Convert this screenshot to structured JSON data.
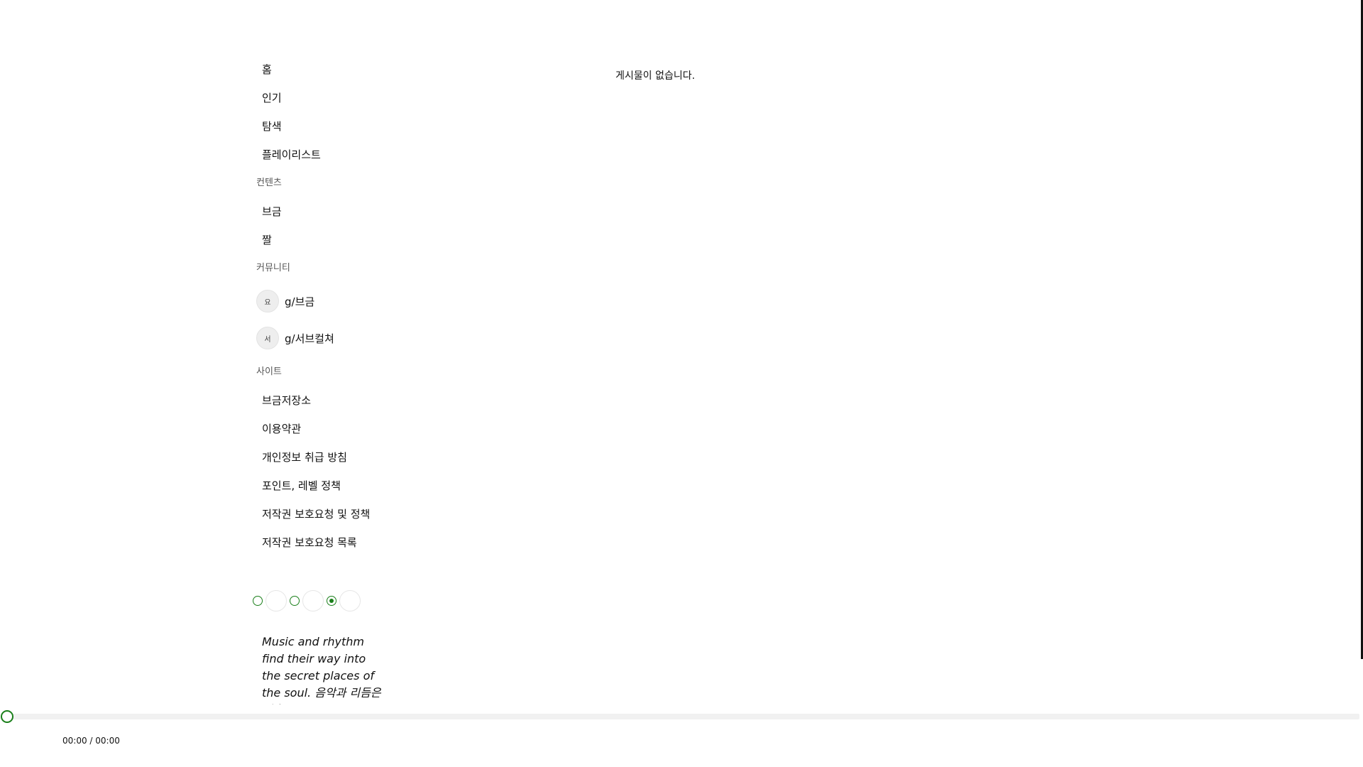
{
  "sidebar": {
    "nav": [
      {
        "label": "홈"
      },
      {
        "label": "인기"
      },
      {
        "label": "탐색"
      },
      {
        "label": "플레이리스트"
      }
    ],
    "content_section": {
      "title": "컨텐츠",
      "items": [
        {
          "label": "브금"
        },
        {
          "label": "짤"
        }
      ]
    },
    "community_section": {
      "title": "커뮤니티",
      "items": [
        {
          "avatar": "요",
          "label": "g/브금"
        },
        {
          "avatar": "서",
          "label": "g/서브컬쳐"
        }
      ]
    },
    "site_section": {
      "title": "사이트",
      "items": [
        {
          "label": "브금저장소"
        },
        {
          "label": "이용약관"
        },
        {
          "label": "개인정보 취급 방침"
        },
        {
          "label": "포인트, 레벨 정책"
        },
        {
          "label": "저작권 보호요청 및 정책"
        },
        {
          "label": "저작권 보호요청 목록"
        }
      ]
    }
  },
  "theme_selector": {
    "selected_index": 2,
    "accent_color": "#1a7f1a"
  },
  "quote": {
    "text": "Music and rhythm find their way into the secret places of the soul. 음악과 리듬은 영혼"
  },
  "main": {
    "empty_message": "게시물이 없습니다."
  },
  "player": {
    "progress": 0,
    "time": "00:00 / 00:00"
  }
}
